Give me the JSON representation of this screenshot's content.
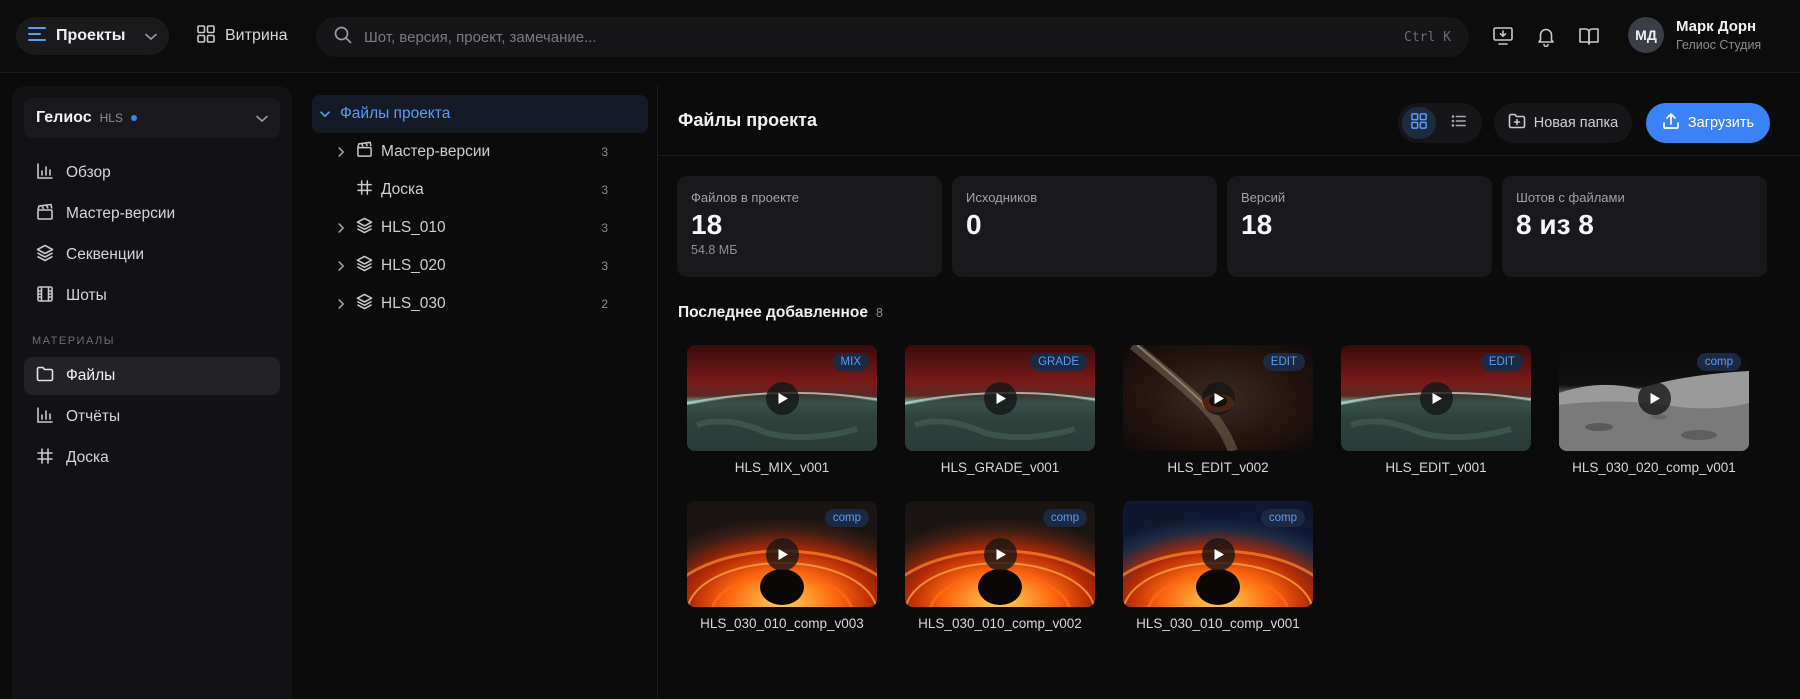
{
  "topbar": {
    "projects_label": "Проекты",
    "vitrina_label": "Витрина",
    "search_placeholder": "Шот, версия, проект, замечание...",
    "search_shortcut": "Ctrl K",
    "user_initials": "МД",
    "user_name": "Марк Дорн",
    "user_org": "Гелиос Студия"
  },
  "sidebar": {
    "project_name": "Гелиос",
    "project_tag": "HLS",
    "items": [
      {
        "label": "Обзор",
        "icon": "chart-icon"
      },
      {
        "label": "Мастер-версии",
        "icon": "clapperboard-icon"
      },
      {
        "label": "Секвенции",
        "icon": "layers-icon"
      },
      {
        "label": "Шоты",
        "icon": "film-icon"
      }
    ],
    "section_label": "МАТЕРИАЛЫ",
    "materials": [
      {
        "label": "Файлы",
        "icon": "folder-icon",
        "active": true
      },
      {
        "label": "Отчёты",
        "icon": "chart-icon"
      },
      {
        "label": "Доска",
        "icon": "hash-icon"
      }
    ]
  },
  "tree": {
    "root_label": "Файлы проекта",
    "items": [
      {
        "label": "Мастер-версии",
        "count": "3",
        "icon": "clapperboard-icon",
        "expandable": true
      },
      {
        "label": "Доска",
        "count": "3",
        "icon": "hash-icon",
        "expandable": false
      },
      {
        "label": "HLS_010",
        "count": "3",
        "icon": "layers-icon",
        "expandable": true
      },
      {
        "label": "HLS_020",
        "count": "3",
        "icon": "layers-icon",
        "expandable": true
      },
      {
        "label": "HLS_030",
        "count": "2",
        "icon": "layers-icon",
        "expandable": true
      }
    ]
  },
  "main": {
    "title": "Файлы проекта",
    "new_folder_label": "Новая папка",
    "upload_label": "Загрузить",
    "stats": [
      {
        "label": "Файлов в проекте",
        "value": "18",
        "sub": "54.8 МБ"
      },
      {
        "label": "Исходников",
        "value": "0",
        "sub": ""
      },
      {
        "label": "Версий",
        "value": "18",
        "sub": ""
      },
      {
        "label": "Шотов с файлами",
        "value": "8 из 8",
        "sub": ""
      }
    ],
    "recent_title": "Последнее добавленное",
    "recent_count": "8",
    "cards": [
      {
        "name": "HLS_MIX_v001",
        "badge": "MIX",
        "scene": "earth"
      },
      {
        "name": "HLS_GRADE_v001",
        "badge": "GRADE",
        "scene": "earth"
      },
      {
        "name": "HLS_EDIT_v002",
        "badge": "EDIT",
        "scene": "galaxy"
      },
      {
        "name": "HLS_EDIT_v001",
        "badge": "EDIT",
        "scene": "earth"
      },
      {
        "name": "HLS_030_020_comp_v001",
        "badge": "comp",
        "scene": "moon"
      },
      {
        "name": "HLS_030_010_comp_v003",
        "badge": "comp",
        "scene": "blackhole"
      },
      {
        "name": "HLS_030_010_comp_v002",
        "badge": "comp",
        "scene": "blackhole"
      },
      {
        "name": "HLS_030_010_comp_v001",
        "badge": "comp",
        "scene": "blackhole2"
      }
    ]
  },
  "colors": {
    "accent": "#3b82f6",
    "badge_text": "#5b9cf6"
  }
}
